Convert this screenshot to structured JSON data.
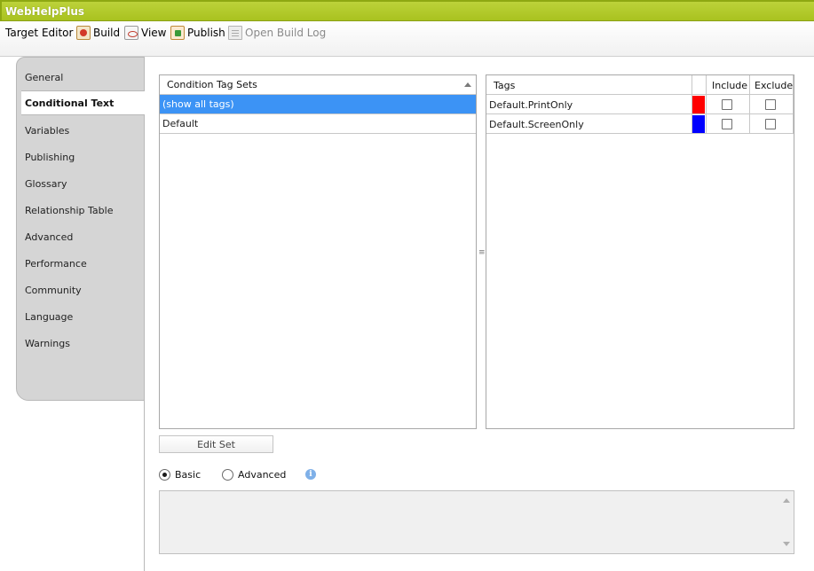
{
  "window": {
    "title": "WebHelpPlus"
  },
  "toolbar": {
    "target_editor": "Target Editor",
    "build": "Build",
    "view": "View",
    "publish": "Publish",
    "open_build_log": "Open Build Log"
  },
  "nav": {
    "items": [
      {
        "label": "General"
      },
      {
        "label": "Conditional Text"
      },
      {
        "label": "Variables"
      },
      {
        "label": "Publishing"
      },
      {
        "label": "Glossary"
      },
      {
        "label": "Relationship Table"
      },
      {
        "label": "Advanced"
      },
      {
        "label": "Performance"
      },
      {
        "label": "Community"
      },
      {
        "label": "Language"
      },
      {
        "label": "Warnings"
      }
    ],
    "active_index": 1
  },
  "tag_sets": {
    "header": "Condition Tag Sets",
    "rows": [
      "(show all tags)",
      "Default"
    ],
    "selected_index": 0
  },
  "tags": {
    "headers": {
      "tags": "Tags",
      "include": "Include",
      "exclude": "Exclude"
    },
    "rows": [
      {
        "name": "Default.PrintOnly",
        "color": "#ff0000",
        "include": false,
        "exclude": false
      },
      {
        "name": "Default.ScreenOnly",
        "color": "#0000ff",
        "include": false,
        "exclude": false
      }
    ]
  },
  "edit_set_label": "Edit Set",
  "mode": {
    "basic": "Basic",
    "advanced": "Advanced",
    "selected": "basic"
  },
  "info_icon_glyph": "i",
  "expression_text": ""
}
